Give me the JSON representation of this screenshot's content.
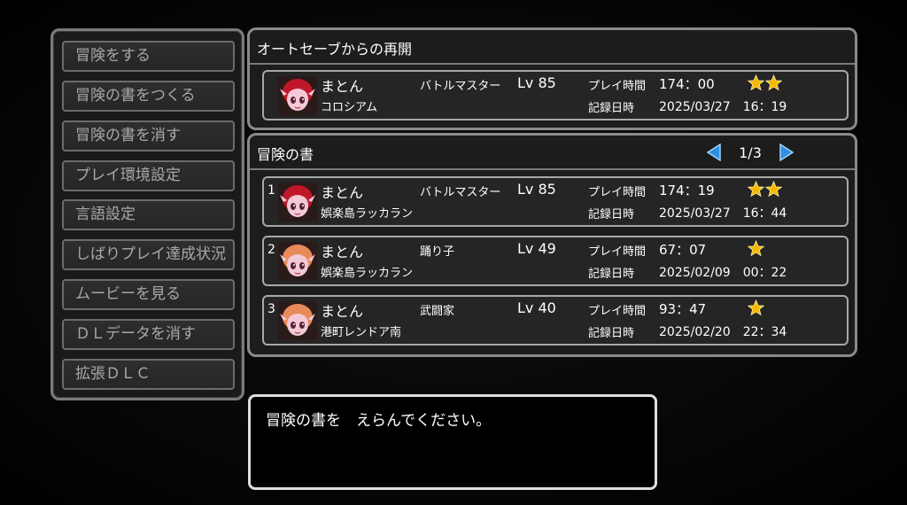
{
  "menu": {
    "items": [
      "冒険をする",
      "冒険の書をつくる",
      "冒険の書を消す",
      "プレイ環境設定",
      "言語設定",
      "しばりプレイ達成状況",
      "ムービーを見る",
      "ＤＬデータを消す",
      "拡張ＤＬＣ"
    ]
  },
  "autosave": {
    "title": "オートセーブからの再開",
    "slot": {
      "name": "まとん",
      "location": "コロシアム",
      "job": "バトルマスター",
      "level": "Lv 85",
      "playtime_label": "プレイ時間",
      "playtime": "174：00",
      "recorded_label": "記録日時",
      "recorded": "2025/03/27　16：19",
      "stars": 2,
      "portrait_color": "#c0182a"
    }
  },
  "adventure_log": {
    "title": "冒険の書",
    "page": "1/3",
    "slots": [
      {
        "index": "1",
        "name": "まとん",
        "location": "娯楽島ラッカラン",
        "job": "バトルマスター",
        "level": "Lv 85",
        "playtime_label": "プレイ時間",
        "playtime": "174：19",
        "recorded_label": "記録日時",
        "recorded": "2025/03/27　16：44",
        "stars": 2,
        "portrait_color": "#c0182a"
      },
      {
        "index": "2",
        "name": "まとん",
        "location": "娯楽島ラッカラン",
        "job": "踊り子",
        "level": "Lv 49",
        "playtime_label": "プレイ時間",
        "playtime": "67：07",
        "recorded_label": "記録日時",
        "recorded": "2025/02/09　00：22",
        "stars": 1,
        "portrait_color": "#e88a5a"
      },
      {
        "index": "3",
        "name": "まとん",
        "location": "港町レンドア南",
        "job": "武闘家",
        "level": "Lv 40",
        "playtime_label": "プレイ時間",
        "playtime": "93：47",
        "recorded_label": "記録日時",
        "recorded": "2025/02/20　22：34",
        "stars": 1,
        "portrait_color": "#e88a5a"
      }
    ]
  },
  "message": "冒険の書を　えらんでください。",
  "colors": {
    "star": "#f5b800",
    "arrow": "#2f8fe0"
  }
}
